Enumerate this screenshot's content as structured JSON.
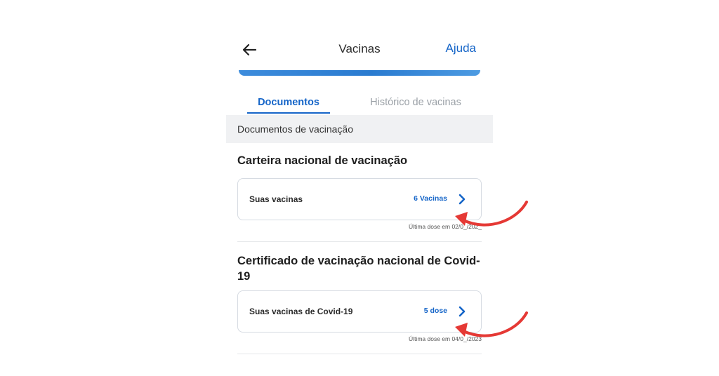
{
  "header": {
    "title": "Vacinas",
    "help_label": "Ajuda"
  },
  "tabs": [
    {
      "label": "Documentos",
      "active": true
    },
    {
      "label": "Histórico de vacinas",
      "active": false
    }
  ],
  "section": {
    "label": "Documentos de vacinação"
  },
  "cards": [
    {
      "title": "Carteira nacional de vacinação",
      "row_label": "Suas vacinas",
      "row_value": "6 Vacinas",
      "last_dose": "Última dose em 02/0_/202_"
    },
    {
      "title_line1": "Certificado de vacinação nacional de Covid-",
      "title_line2": "19",
      "row_label": "Suas vacinas de Covid-19",
      "row_value": "5 dose",
      "last_dose": "Última dose em 04/0_/2023"
    }
  ],
  "colors": {
    "accent": "#1565c8",
    "annotation_arrow": "#e53935"
  }
}
